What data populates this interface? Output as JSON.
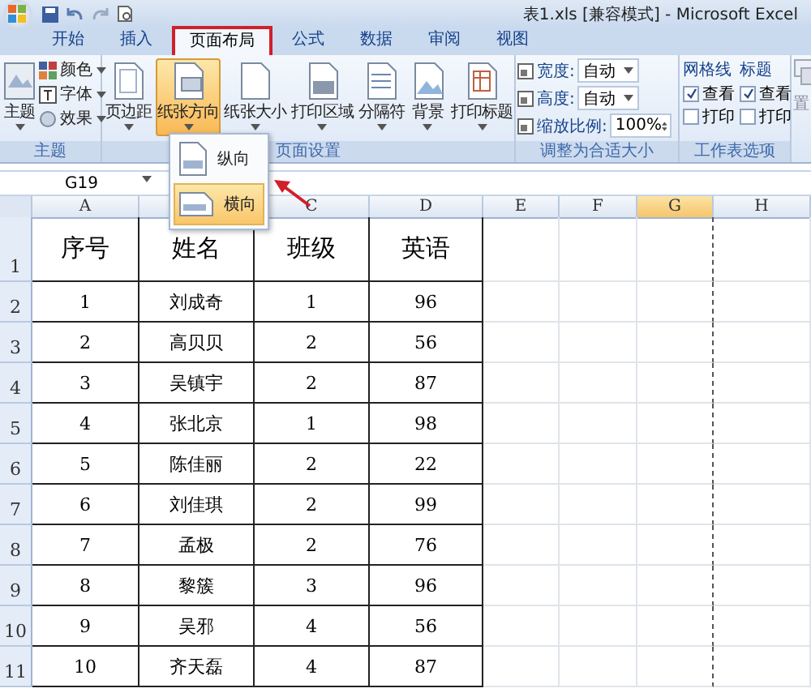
{
  "window": {
    "title": "表1.xls [兼容模式] - Microsoft Excel"
  },
  "tabs": [
    {
      "label": "开始",
      "selected": false
    },
    {
      "label": "插入",
      "selected": false
    },
    {
      "label": "页面布局",
      "selected": true
    },
    {
      "label": "公式",
      "selected": false
    },
    {
      "label": "数据",
      "selected": false
    },
    {
      "label": "审阅",
      "selected": false
    },
    {
      "label": "视图",
      "selected": false
    }
  ],
  "theme_group": {
    "title": "主题",
    "button": "主题",
    "items": [
      "颜色",
      "字体",
      "效果"
    ]
  },
  "page_setup": {
    "title": "页面设置",
    "buttons": [
      {
        "label": "页边距",
        "selected": false
      },
      {
        "label": "纸张方向",
        "selected": true
      },
      {
        "label": "纸张大小",
        "selected": false
      },
      {
        "label": "打印区域",
        "selected": false
      },
      {
        "label": "分隔符",
        "selected": false
      },
      {
        "label": "背景",
        "selected": false
      },
      {
        "label": "打印标题",
        "selected": false
      }
    ]
  },
  "scale_fit": {
    "title": "调整为合适大小",
    "fields": [
      {
        "label": "宽度:",
        "value": "自动",
        "kind": "dropdown"
      },
      {
        "label": "高度:",
        "value": "自动",
        "kind": "dropdown"
      },
      {
        "label": "缩放比例:",
        "value": "100%",
        "kind": "spinner"
      }
    ]
  },
  "sheet_options": {
    "title": "工作表选项",
    "columns": [
      {
        "heading": "网格线",
        "options": [
          {
            "label": "查看",
            "checked": true
          },
          {
            "label": "打印",
            "checked": false
          }
        ]
      },
      {
        "heading": "标题",
        "options": [
          {
            "label": "查看",
            "checked": true
          },
          {
            "label": "打印",
            "checked": false
          }
        ]
      }
    ]
  },
  "arrange_group": {
    "label": "置"
  },
  "dropdown": {
    "items": [
      {
        "label": "纵向",
        "selected": false
      },
      {
        "label": "横向",
        "selected": true
      }
    ]
  },
  "name_box": "G19",
  "sheet": {
    "columns": [
      {
        "label": "A",
        "selected": false
      },
      {
        "selected": false
      },
      {
        "label": "C",
        "selected": false
      },
      {
        "label": "D",
        "selected": false
      },
      {
        "label": "E",
        "selected": false
      },
      {
        "label": "F",
        "selected": false
      },
      {
        "label": "G",
        "selected": true
      },
      {
        "label": "H",
        "selected": false
      }
    ],
    "rows": [
      {
        "number": "1",
        "cells": [
          "序号",
          "姓名",
          "班级",
          "英语"
        ]
      },
      {
        "number": "2",
        "cells": [
          "1",
          "刘成奇",
          "1",
          "96"
        ]
      },
      {
        "number": "3",
        "cells": [
          "2",
          "高贝贝",
          "2",
          "56"
        ]
      },
      {
        "number": "4",
        "cells": [
          "3",
          "吴镇宇",
          "2",
          "87"
        ]
      },
      {
        "number": "5",
        "cells": [
          "4",
          "张北京",
          "1",
          "98"
        ]
      },
      {
        "number": "6",
        "cells": [
          "5",
          "陈佳丽",
          "2",
          "22"
        ]
      },
      {
        "number": "7",
        "cells": [
          "6",
          "刘佳琪",
          "2",
          "99"
        ]
      },
      {
        "number": "8",
        "cells": [
          "7",
          "孟极",
          "2",
          "76"
        ]
      },
      {
        "number": "9",
        "cells": [
          "8",
          "黎簇",
          "3",
          "96"
        ]
      },
      {
        "number": "10",
        "cells": [
          "9",
          "吴邪",
          "4",
          "56"
        ]
      },
      {
        "number": "11",
        "cells": [
          "10",
          "齐天磊",
          "4",
          "87"
        ]
      }
    ]
  }
}
